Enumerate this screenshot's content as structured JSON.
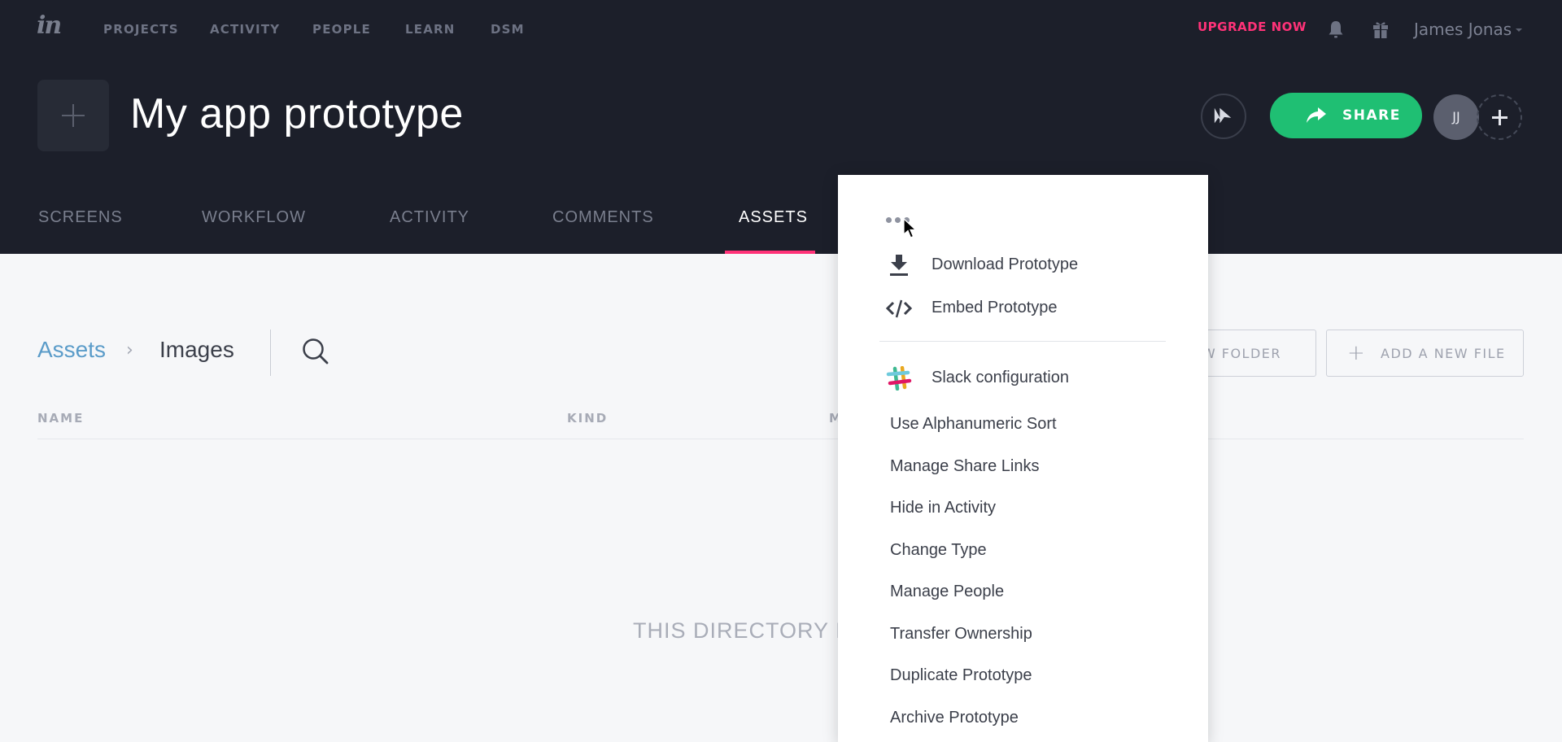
{
  "app": {
    "logo_text": "in",
    "nav": [
      "PROJECTS",
      "ACTIVITY",
      "PEOPLE",
      "LEARN",
      "DSM"
    ],
    "upgrade_label": "UPGRADE NOW",
    "user_name": "James Jonas",
    "icons": {
      "notifications": "bell-icon",
      "gifts": "gift-icon"
    }
  },
  "project": {
    "title": "My app prototype",
    "share_label": "SHARE",
    "avatar_initials": "JJ",
    "accent_color": "#ff3278",
    "share_color": "#1fbf73"
  },
  "tabs": [
    {
      "label": "SCREENS",
      "active": false
    },
    {
      "label": "WORKFLOW",
      "active": false
    },
    {
      "label": "ACTIVITY",
      "active": false
    },
    {
      "label": "COMMENTS",
      "active": false
    },
    {
      "label": "ASSETS",
      "active": true
    }
  ],
  "content": {
    "breadcrumb": {
      "root": "Assets",
      "separator": "›",
      "current": "Images"
    },
    "buttons": {
      "new_folder": "ADD A NEW FOLDER",
      "new_folder_visible": "EW FOLDER",
      "new_file": "ADD A NEW FILE",
      "plus": "+"
    },
    "columns": [
      "NAME",
      "KIND",
      "M"
    ],
    "empty_message": "THIS DIRECTORY IS EMPTY",
    "empty_message_visible": "THIS DIRECTORY IS"
  },
  "menu": {
    "trigger": "more-options",
    "primary_items": [
      {
        "label": "Download Prototype",
        "icon": "download-icon"
      },
      {
        "label": "Embed Prototype",
        "icon": "code-icon"
      }
    ],
    "slack_item": {
      "label": "Slack configuration",
      "icon": "slack-icon"
    },
    "items": [
      "Use Alphanumeric Sort",
      "Manage Share Links",
      "Hide in Activity",
      "Change Type",
      "Manage People",
      "Transfer Ownership",
      "Duplicate Prototype",
      "Archive Prototype"
    ]
  }
}
